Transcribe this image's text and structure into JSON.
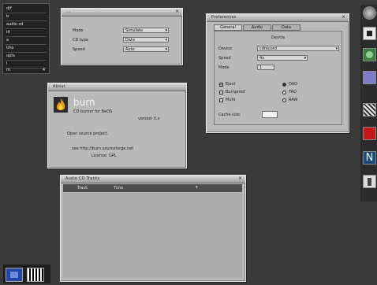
{
  "left_panel": {
    "items": [
      {
        "label": "d/f",
        "value": ""
      },
      {
        "label": "b",
        "value": ""
      },
      {
        "label": "audio cd",
        "value": ""
      },
      {
        "label": "id",
        "value": ""
      },
      {
        "label": "a",
        "value": ""
      },
      {
        "label": "trks",
        "value": ""
      },
      {
        "label": "opts",
        "value": ""
      },
      {
        "label": "l",
        "value": ""
      },
      {
        "label": "m",
        "value": "4"
      }
    ]
  },
  "window_top": {
    "title": "...",
    "rows": [
      {
        "label": "Mode",
        "value": "Simulate"
      },
      {
        "label": "CD type",
        "value": "Data"
      },
      {
        "label": "Speed",
        "value": "Auto"
      }
    ]
  },
  "window_about": {
    "title": "About",
    "app_name": "burn",
    "line1": "CD burner for BeOS",
    "line2": "version 0.x",
    "line3": "Open source project.",
    "line4": "see http://burn.sourceforge.net",
    "line5": "License: GPL"
  },
  "window_prefs": {
    "title": "Preferences",
    "tabs": [
      "General",
      "Audio",
      "Data"
    ],
    "section": "Device",
    "rows": [
      {
        "label": "Device",
        "value": "cdrecord"
      },
      {
        "label": "Speed",
        "value": "4x"
      },
      {
        "label": "Mode",
        "value": "1"
      }
    ],
    "checks": [
      {
        "label": "Eject",
        "checked": true
      },
      {
        "label": "Burnproof",
        "checked": false
      },
      {
        "label": "Multi",
        "checked": false
      }
    ],
    "radios": [
      {
        "label": "DAO",
        "selected": true
      },
      {
        "label": "TAO",
        "selected": false
      },
      {
        "label": "RAW",
        "selected": false
      }
    ],
    "cache_label": "Cache size:",
    "cache_value": ""
  },
  "window_audio": {
    "title": "Audio CD Tracks",
    "col1": "Track",
    "col2": "Time"
  },
  "dock": {
    "icons": [
      "app-icon",
      "media-icon",
      "network-icon",
      "settings-icon",
      "folder-icon",
      "disk-icon",
      "terminal-icon",
      "file-icon"
    ]
  },
  "tray": {
    "icons": [
      "screen-icon",
      "grid-icon"
    ]
  }
}
